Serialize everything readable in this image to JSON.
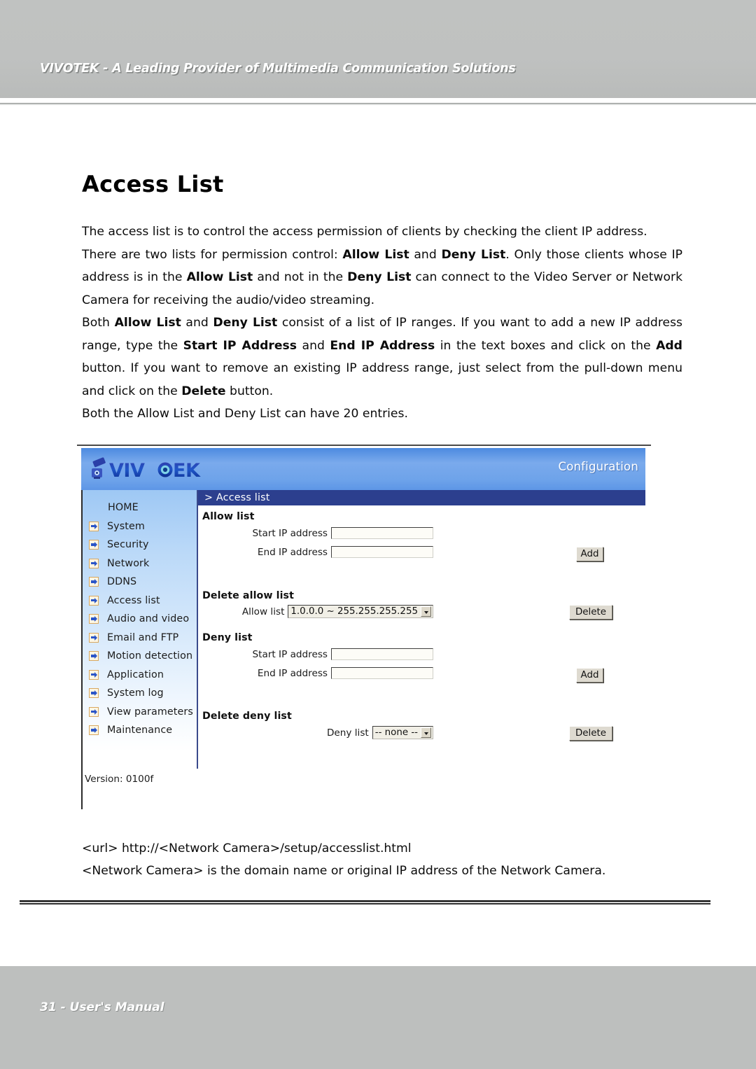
{
  "header": {
    "title": "VIVOTEK - A Leading Provider of Multimedia Communication Solutions"
  },
  "page": {
    "title": "Access List",
    "paragraphs": [
      "The access list is to control the access permission of clients by checking the client IP address.",
      "There are two lists for permission control: Allow List and Deny List. Only those clients whose IP address is in the Allow List and not in the Deny List can connect to the Video Server or Network Camera for receiving the audio/video streaming.",
      "Both Allow List and Deny List consist of a list of IP ranges. If you want to add a new IP address range, type the Start IP Address and End IP Address in the text boxes and click on the Add button. If you want to remove an existing IP address range, just select from the pull-down menu and click on the Delete button.",
      "Both the Allow List and Deny List can have 20 entries."
    ],
    "para1": "The access list is to control the access permission of clients by checking the client IP address.",
    "para2_a": "There are two lists for permission control: ",
    "para2_b1": "Allow List",
    "para2_c": " and ",
    "para2_b2": "Deny List",
    "para2_d": ". Only those clients whose IP address is in the ",
    "para2_b3": "Allow List",
    "para2_e": " and not in the ",
    "para2_b4": "Deny List",
    "para2_f": " can connect to the Video Server or Network Camera for receiving the audio/video streaming.",
    "para3_a": "Both ",
    "para3_b1": "Allow List",
    "para3_b": " and ",
    "para3_b2": "Deny List",
    "para3_c": " consist of a list of IP ranges. If you want to add a new IP address range, type the ",
    "para3_b3": "Start IP Address",
    "para3_d": " and ",
    "para3_b4": "End IP Address",
    "para3_e": " in the text boxes and click on the ",
    "para3_b5": "Add",
    "para3_f": " button. If you want to remove an existing IP address range, just select from the pull-down menu and click on the ",
    "para3_b6": "Delete",
    "para3_g": " button.",
    "para4": "Both the Allow List and Deny List can have 20 entries."
  },
  "screenshot": {
    "brand": "VIVOTEK",
    "configuration_label": "Configuration",
    "breadcrumb": "> Access list",
    "sidebar": {
      "items": [
        {
          "label": "HOME",
          "has_icon": false
        },
        {
          "label": "System",
          "has_icon": true
        },
        {
          "label": "Security",
          "has_icon": true
        },
        {
          "label": "Network",
          "has_icon": true
        },
        {
          "label": "DDNS",
          "has_icon": true
        },
        {
          "label": "Access list",
          "has_icon": true
        },
        {
          "label": "Audio and video",
          "has_icon": true
        },
        {
          "label": "Email and FTP",
          "has_icon": true
        },
        {
          "label": "Motion detection",
          "has_icon": true
        },
        {
          "label": "Application",
          "has_icon": true
        },
        {
          "label": "System log",
          "has_icon": true
        },
        {
          "label": "View parameters",
          "has_icon": true
        },
        {
          "label": "Maintenance",
          "has_icon": true
        }
      ],
      "version": "Version: 0100f"
    },
    "sections": {
      "allow_list_heading": "Allow list",
      "allow_start_label": "Start IP address",
      "allow_start_value": "",
      "allow_end_label": "End IP address",
      "allow_end_value": "",
      "allow_add_button": "Add",
      "delete_allow_heading": "Delete allow list",
      "delete_allow_label": "Allow list",
      "delete_allow_value": "1.0.0.0 ~ 255.255.255.255",
      "delete_allow_button": "Delete",
      "deny_list_heading": "Deny list",
      "deny_start_label": "Start IP address",
      "deny_start_value": "",
      "deny_end_label": "End IP address",
      "deny_end_value": "",
      "deny_add_button": "Add",
      "delete_deny_heading": "Delete deny list",
      "delete_deny_label": "Deny list",
      "delete_deny_value": "-- none --",
      "delete_deny_button": "Delete"
    }
  },
  "url_notes": {
    "line1": "<url> http://<Network Camera>/setup/accesslist.html",
    "line2": "<Network Camera> is the domain name or original IP address of the Network Camera."
  },
  "footer": {
    "text": "31 - User's Manual"
  },
  "colors": {
    "band_gray": "#bdbfbe",
    "header_blue": "#6ea3ea",
    "navy": "#2c3f8e",
    "sidebar_blue": "#9ec8f4",
    "button_face": "#dedad0"
  }
}
